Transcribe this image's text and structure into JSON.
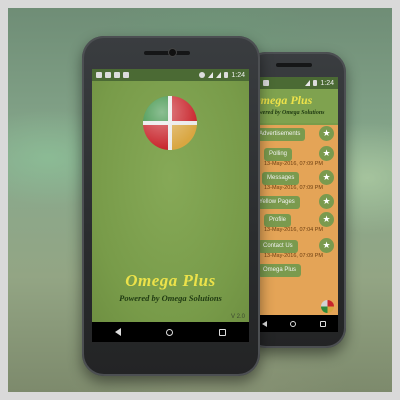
{
  "statusbar": {
    "time": "1:24"
  },
  "splash": {
    "title": "Omega Plus",
    "subtitle": "Powered by Omega Solutions",
    "version": "V 2.0"
  },
  "back_screen": {
    "title": "Omega Plus",
    "subtitle": "Powered by Omega Solutions",
    "menu": [
      {
        "label": "Advertisements",
        "date": ""
      },
      {
        "label": "Polling",
        "date": "13-May-2016, 07:09 PM"
      },
      {
        "label": "Messages",
        "date": "13-May-2016, 07:09 PM"
      },
      {
        "label": "Yellow Pages",
        "date": ""
      },
      {
        "label": "Profile",
        "date": "13-May-2016, 07:04 PM"
      },
      {
        "label": "Contact Us",
        "date": "13-May-2016, 07:09 PM"
      },
      {
        "label": "Omega Plus",
        "date": ""
      }
    ],
    "star_icon": "★"
  },
  "colors": {
    "screen_green": "#7fa24f",
    "title_yellow": "#ece24a",
    "menu_orange": "#e4a457",
    "logo_red": "#c8242b",
    "logo_green": "#2e8a3a"
  }
}
